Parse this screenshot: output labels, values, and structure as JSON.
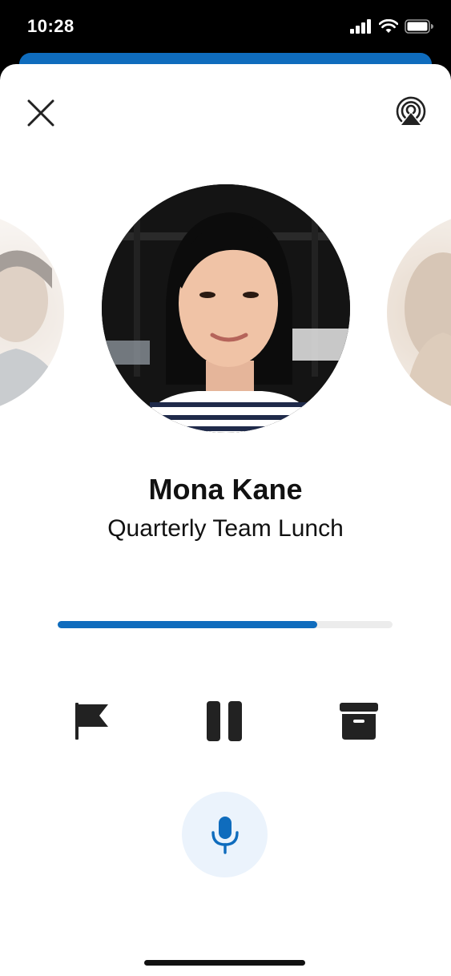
{
  "status_bar": {
    "time": "10:28",
    "icons": [
      "cellular-signal-icon",
      "wifi-icon",
      "battery-icon"
    ]
  },
  "header": {
    "close_icon": "close-icon",
    "cast_icon": "airplay-icon"
  },
  "contact": {
    "name": "Mona Kane",
    "subtitle": "Quarterly Team Lunch"
  },
  "playback": {
    "progress": 0.775
  },
  "controls": {
    "flag_icon": "flag-icon",
    "pause_icon": "pause-icon",
    "archive_icon": "archive-icon",
    "mic_icon": "microphone-icon"
  },
  "colors": {
    "accent": "#0f6cbd",
    "mic_background": "#ebf3fc",
    "text": "#111111",
    "progress_track": "#ececec"
  }
}
